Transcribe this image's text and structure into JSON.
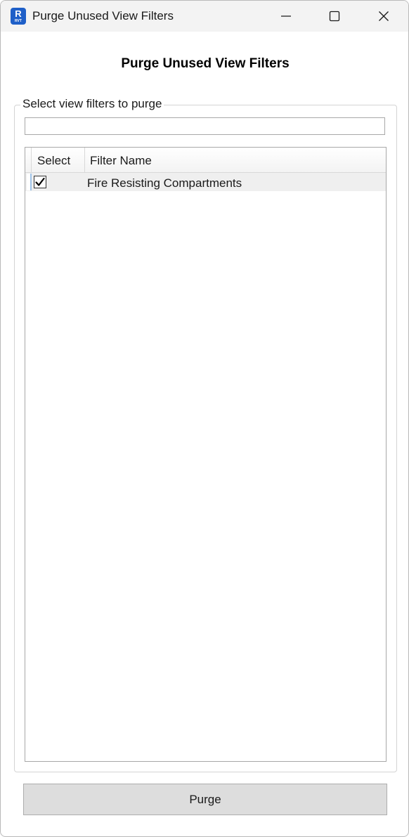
{
  "window": {
    "title": "Purge Unused View Filters",
    "app_icon": {
      "letter": "R",
      "caption": "RVT",
      "color": "#1e5fc8"
    },
    "controls": [
      "minimize-icon",
      "maximize-icon",
      "close-icon"
    ]
  },
  "main": {
    "heading": "Purge Unused View Filters",
    "group_label": "Select view filters to purge",
    "search": {
      "value": "",
      "placeholder": ""
    },
    "grid": {
      "columns": [
        "Select",
        "Filter Name"
      ],
      "rows": [
        {
          "selected": true,
          "filter_name": "Fire Resisting Compartments"
        }
      ]
    },
    "purge_label": "Purge"
  },
  "colors": {
    "titlebar": "#f3f3f3",
    "selected_row": "#efefef",
    "button": "#dddddd",
    "row_marker": "#9fc3e8"
  }
}
